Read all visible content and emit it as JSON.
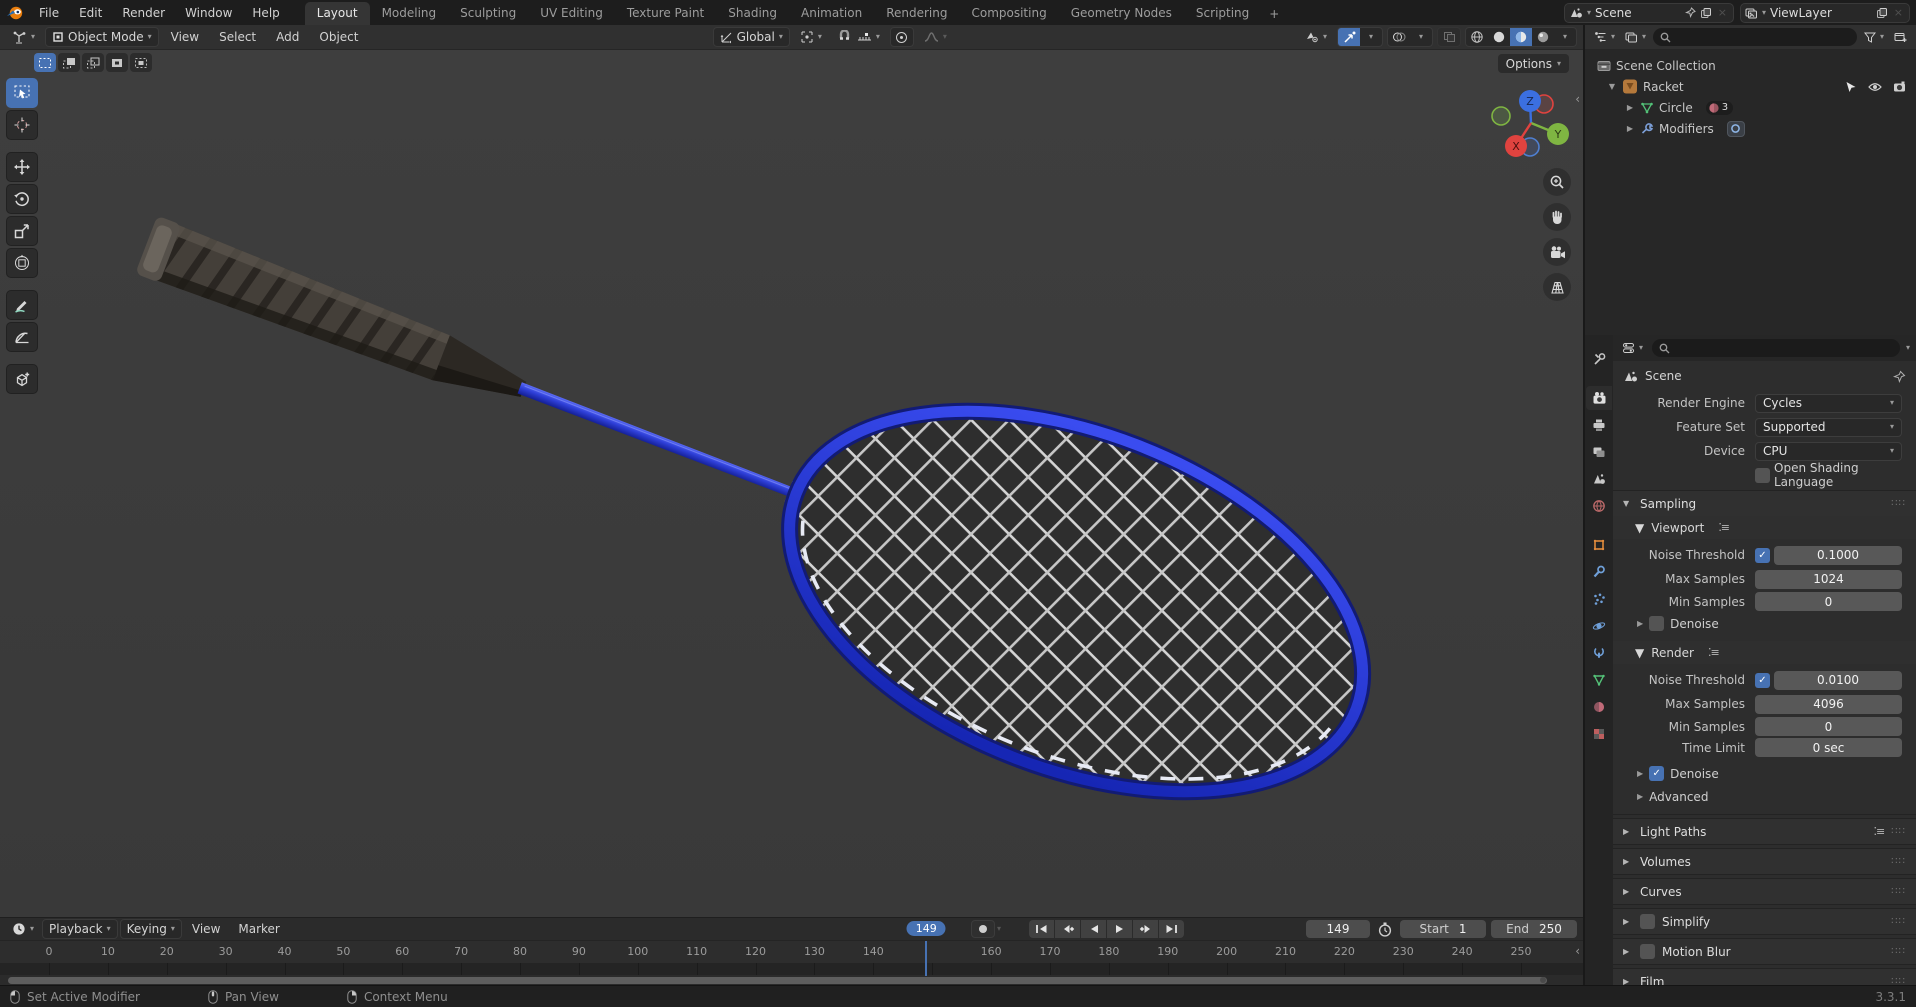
{
  "topbar": {
    "menus": [
      "File",
      "Edit",
      "Render",
      "Window",
      "Help"
    ],
    "workspaces": [
      {
        "label": "Layout",
        "active": true
      },
      {
        "label": "Modeling"
      },
      {
        "label": "Sculpting"
      },
      {
        "label": "UV Editing"
      },
      {
        "label": "Texture Paint"
      },
      {
        "label": "Shading"
      },
      {
        "label": "Animation"
      },
      {
        "label": "Rendering"
      },
      {
        "label": "Compositing"
      },
      {
        "label": "Geometry Nodes"
      },
      {
        "label": "Scripting"
      }
    ],
    "add_workspace": "+",
    "scene": {
      "value": "Scene"
    },
    "view_layer": {
      "value": "ViewLayer"
    }
  },
  "viewport": {
    "header": {
      "mode": "Object Mode",
      "menus": [
        "View",
        "Select",
        "Add",
        "Object"
      ],
      "orientation": "Global",
      "options": "Options"
    },
    "gizmo_axes": {
      "x": "X",
      "y": "Y",
      "z": "Z"
    }
  },
  "outliner": {
    "rows": [
      {
        "label": "Scene Collection"
      },
      {
        "label": "Racket"
      },
      {
        "label": "Circle",
        "badge": "3"
      },
      {
        "label": "Modifiers"
      }
    ]
  },
  "properties": {
    "breadcrumb": "Scene",
    "render_engine": {
      "label": "Render Engine",
      "value": "Cycles"
    },
    "feature_set": {
      "label": "Feature Set",
      "value": "Supported"
    },
    "device": {
      "label": "Device",
      "value": "CPU"
    },
    "osl": {
      "label": "Open Shading Language",
      "checked": false
    },
    "sampling": {
      "title": "Sampling",
      "viewport": {
        "title": "Viewport",
        "noise_threshold": {
          "label": "Noise Threshold",
          "checked": true,
          "value": "0.1000"
        },
        "max_samples": {
          "label": "Max Samples",
          "value": "1024"
        },
        "min_samples": {
          "label": "Min Samples",
          "value": "0"
        },
        "denoise": {
          "label": "Denoise",
          "checked": false
        }
      },
      "render": {
        "title": "Render",
        "noise_threshold": {
          "label": "Noise Threshold",
          "checked": true,
          "value": "0.0100"
        },
        "max_samples": {
          "label": "Max Samples",
          "value": "4096"
        },
        "min_samples": {
          "label": "Min Samples",
          "value": "0"
        },
        "time_limit": {
          "label": "Time Limit",
          "value": "0 sec"
        },
        "denoise": {
          "label": "Denoise",
          "checked": true
        },
        "advanced": "Advanced"
      }
    },
    "sections": [
      {
        "label": "Light Paths",
        "has_preset": true
      },
      {
        "label": "Volumes"
      },
      {
        "label": "Curves"
      },
      {
        "label": "Simplify",
        "has_checkbox": true,
        "checked": false
      },
      {
        "label": "Motion Blur",
        "has_checkbox": true,
        "checked": false
      },
      {
        "label": "Film"
      }
    ]
  },
  "timeline": {
    "menus": [
      "Playback",
      "Keying",
      "View",
      "Marker"
    ],
    "current_frame": "149",
    "playhead_frame": 149,
    "start_label": "Start",
    "start_value": "1",
    "end_label": "End",
    "end_value": "250",
    "ruler": {
      "start": 0,
      "end": 250,
      "step": 10
    }
  },
  "status_bar": {
    "hints": [
      {
        "label": "Set Active Modifier"
      },
      {
        "label": "Pan View"
      },
      {
        "label": "Context Menu"
      }
    ],
    "version": "3.3.1"
  },
  "colors": {
    "accent": "#4772b3",
    "racket_frame": "#2435d8",
    "axis_x": "#e0433f",
    "axis_y": "#7fb542",
    "axis_z": "#3b6fe0"
  },
  "icons": {
    "blender-logo-icon": "orange blender mark",
    "chevron-down-icon": "▾",
    "search-icon": "magnifier",
    "pin-icon": "pushpin",
    "copy-icon": "duplicate pages",
    "close-icon": "×",
    "collection-icon": "box",
    "object-icon": "orange triangle tile",
    "mesh-data-icon": "green triangle",
    "modifier-wrench-icon": "blue wrench",
    "material-count-icon": "red sphere",
    "screw-modifier-icon": "blue ring tile",
    "pointer-icon": "cursor arrow",
    "eye-icon": "eye",
    "camera-icon": "camera",
    "grip-dots-icon": "∷",
    "preset-list-icon": "list with dots",
    "clock-icon": "clock",
    "stopwatch-icon": "stopwatch",
    "record-icon": "filled circle",
    "mouse-left-icon": "mouse LMB",
    "mouse-middle-icon": "mouse MMB",
    "mouse-right-icon": "mouse RMB",
    "magnet-icon": "snap magnet",
    "orientation-globe-icon": "orientation globe",
    "pivot-icon": "pivot point",
    "proportional-icon": "proportional editing circle",
    "falloff-icon": "falloff curve",
    "visibility-icon": "object visibility",
    "gizmo-toggle-icon": "gizmo arrow",
    "overlays-icon": "two overlapping circles",
    "xray-icon": "two overlapping squares",
    "shading-wireframe-icon": "wire sphere",
    "shading-solid-icon": "solid sphere",
    "shading-material-icon": "material sphere",
    "shading-rendered-icon": "rendered sphere",
    "zoom-icon": "magnifier plus",
    "hand-icon": "pan hand",
    "view-camera-icon": "movie camera",
    "ortho-grid-icon": "perspective grid",
    "axis-gizmo-icon": "XYZ navigation balls"
  }
}
